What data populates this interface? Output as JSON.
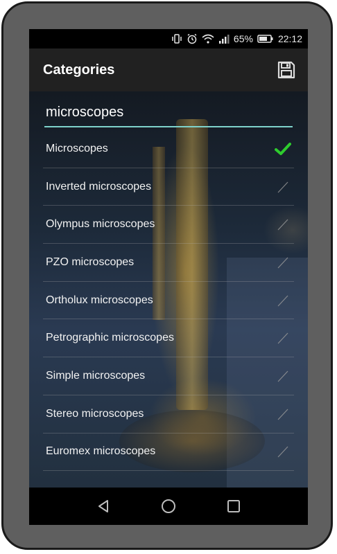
{
  "status_bar": {
    "battery_percent": "65%",
    "time": "22:12",
    "icons": [
      "vibrate-icon",
      "alarm-icon",
      "wifi-icon",
      "signal-icon",
      "battery-icon"
    ]
  },
  "app_bar": {
    "title": "Categories",
    "save_icon": "save-icon"
  },
  "search": {
    "value": "microscopes"
  },
  "colors": {
    "accent_underline": "#7fd4cc",
    "checked": "#2ecc2e",
    "unchecked": "#9a9a9a"
  },
  "categories": [
    {
      "label": "Microscopes",
      "checked": true
    },
    {
      "label": "Inverted microscopes",
      "checked": false
    },
    {
      "label": "Olympus microscopes",
      "checked": false
    },
    {
      "label": "PZO microscopes",
      "checked": false
    },
    {
      "label": "Ortholux microscopes",
      "checked": false
    },
    {
      "label": "Petrographic microscopes",
      "checked": false
    },
    {
      "label": "Simple microscopes",
      "checked": false
    },
    {
      "label": "Stereo microscopes",
      "checked": false
    },
    {
      "label": "Euromex microscopes",
      "checked": false
    }
  ],
  "nav_bar": {
    "buttons": [
      "back-icon",
      "home-icon",
      "recents-icon"
    ]
  }
}
